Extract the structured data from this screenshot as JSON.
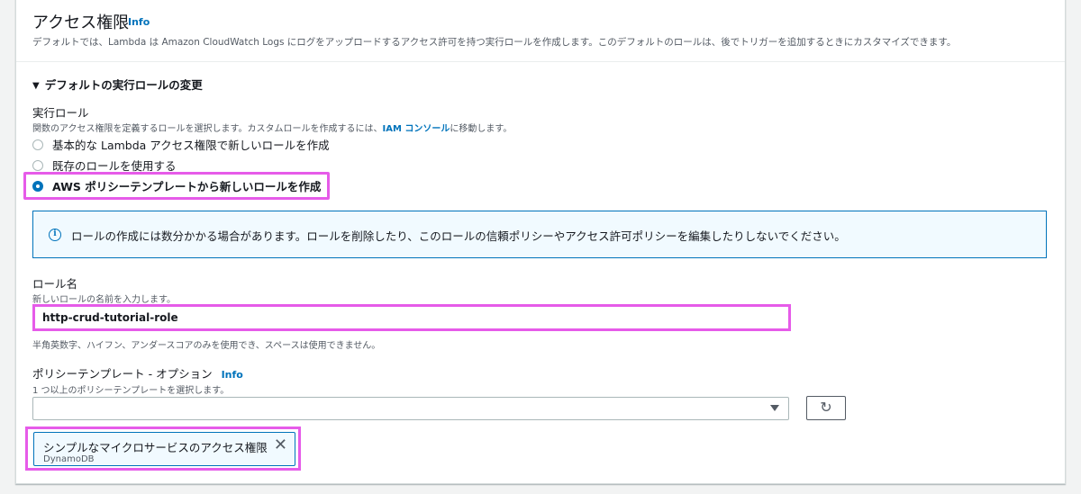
{
  "section": {
    "title": "アクセス権限",
    "info": "Info",
    "description": "デフォルトでは、Lambda は Amazon CloudWatch Logs にログをアップロードするアクセス許可を持つ実行ロールを作成します。このデフォルトのロールは、後でトリガーを追加するときにカスタマイズできます。"
  },
  "expander": {
    "label": "デフォルトの実行ロールの変更",
    "icon": "caret-down-icon"
  },
  "execution_role": {
    "label": "実行ロール",
    "description_before": "関数のアクセス権限を定義するロールを選択します。カスタムロールを作成するには、",
    "description_link": "IAM コンソール",
    "description_after": "に移動します。",
    "options": [
      {
        "label": "基本的な Lambda アクセス権限で新しいロールを作成",
        "checked": false
      },
      {
        "label": "既存のロールを使用する",
        "checked": false
      },
      {
        "label": "AWS ポリシーテンプレートから新しいロールを作成",
        "checked": true
      }
    ]
  },
  "alert": {
    "icon": "info-icon",
    "text": "ロールの作成には数分かかる場合があります。ロールを削除したり、このロールの信頼ポリシーやアクセス許可ポリシーを編集したりしないでください。"
  },
  "role_name": {
    "label": "ロール名",
    "description": "新しいロールの名前を入力します。",
    "value": "http-crud-tutorial-role",
    "constraint": "半角英数字、ハイフン、アンダースコアのみを使用でき、スペースは使用できません。"
  },
  "policy_templates": {
    "label": "ポリシーテンプレート - オプション",
    "info": "Info",
    "description": "1 つ以上のポリシーテンプレートを選択します。",
    "selected_value": "",
    "refresh_icon": "refresh-icon",
    "tokens": [
      {
        "label": "シンプルなマイクロサービスのアクセス権限",
        "sublabel": "DynamoDB"
      }
    ]
  },
  "colors": {
    "accent": "#0073bb",
    "highlight": "#e65be9",
    "alert_bg": "#f1faff"
  }
}
